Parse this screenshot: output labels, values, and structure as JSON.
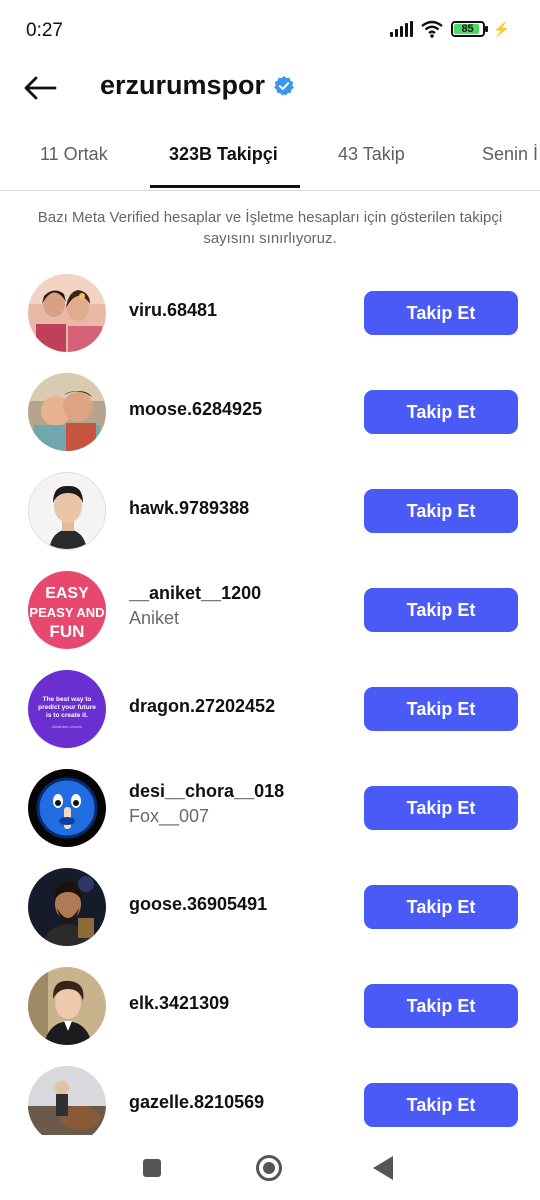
{
  "status_bar": {
    "time": "0:27",
    "battery": "85"
  },
  "header": {
    "title": "erzurumspor"
  },
  "tabs": [
    {
      "label": "11 Ortak"
    },
    {
      "label": "323B Takipçi"
    },
    {
      "label": "43 Takip"
    },
    {
      "label": "Senin İ"
    }
  ],
  "notice": "Bazı Meta Verified hesaplar ve İşletme hesapları için gösterilen takipçi sayısını sınırlıyoruz.",
  "follow_label": "Takip Et",
  "followers": [
    {
      "username": "viru.68481",
      "subname": ""
    },
    {
      "username": "moose.6284925",
      "subname": ""
    },
    {
      "username": "hawk.9789388",
      "subname": ""
    },
    {
      "username": "__aniket__1200",
      "subname": "Aniket"
    },
    {
      "username": "dragon.27202452",
      "subname": ""
    },
    {
      "username": "desi__chora__018",
      "subname": "Fox__007"
    },
    {
      "username": "goose.36905491",
      "subname": ""
    },
    {
      "username": "elk.3421309",
      "subname": ""
    },
    {
      "username": "gazelle.8210569",
      "subname": ""
    }
  ],
  "avatar_texts": {
    "aniket": [
      "EASY",
      "PEASY AND",
      "FUN"
    ],
    "dragon_quote": [
      "The best way to",
      "predict your future",
      "is to create it."
    ],
    "dragon_author": "Abraham Lincoln"
  },
  "colors": {
    "accent": "#4a5af6",
    "verified": "#3897f0"
  }
}
